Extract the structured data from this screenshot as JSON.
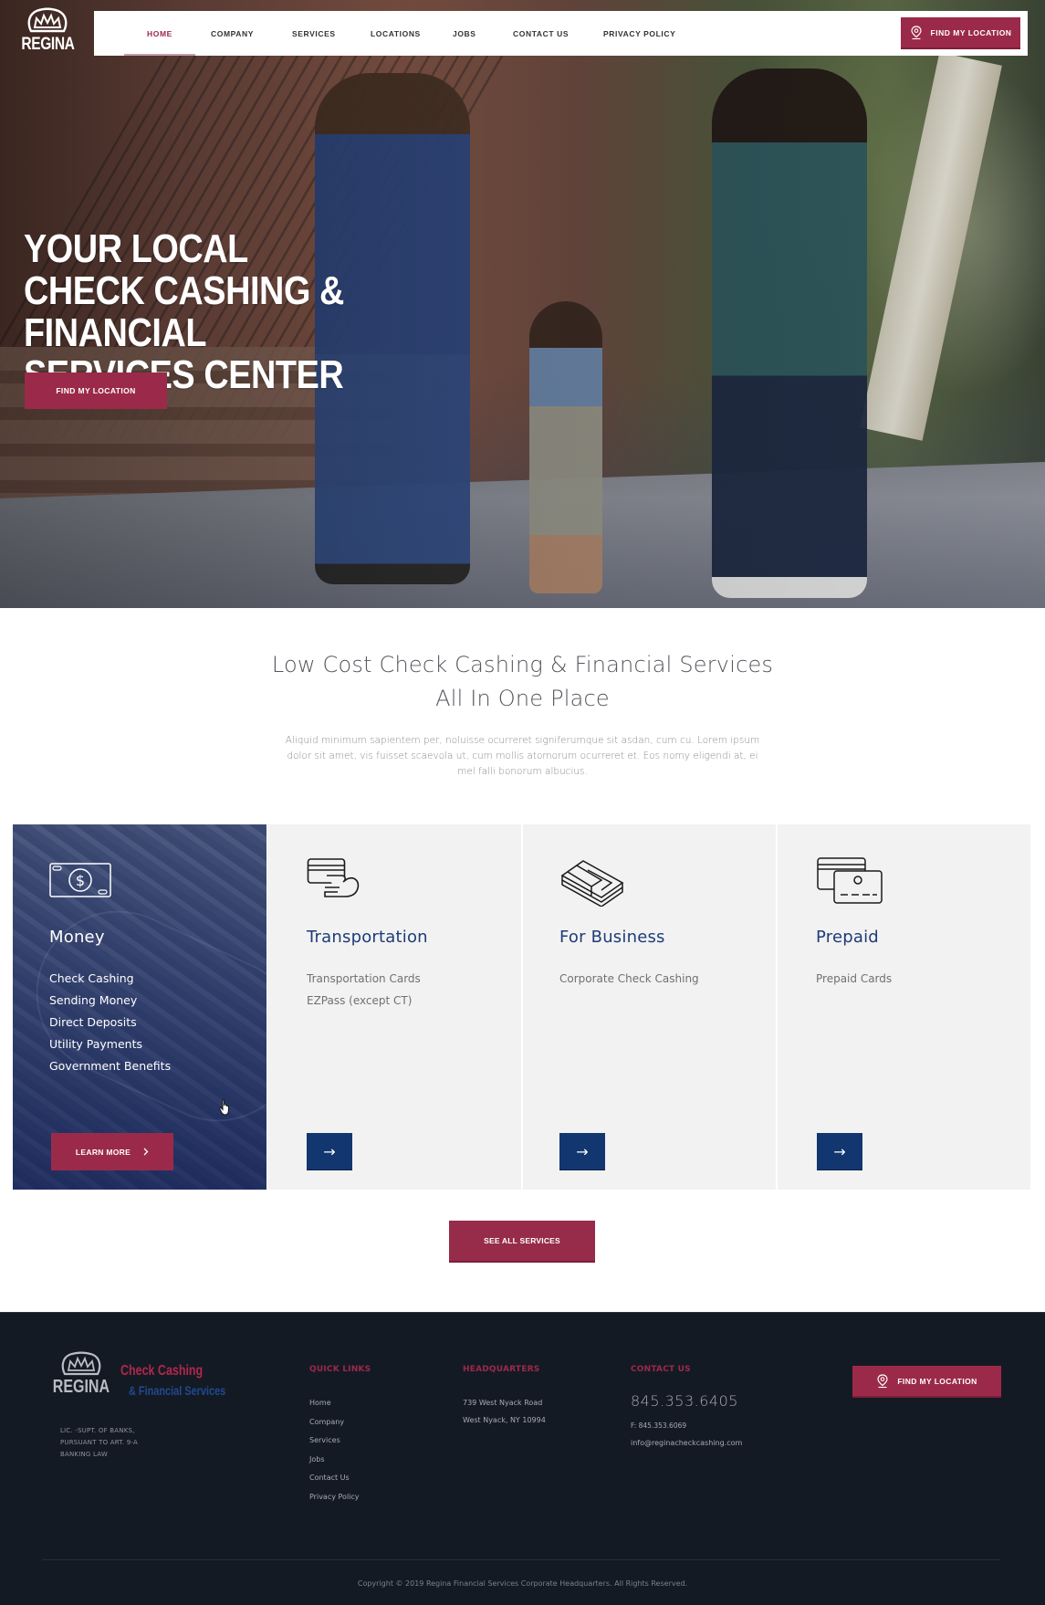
{
  "brand": {
    "logo_word": "REGINA",
    "colors": {
      "primary": "#9b2a4a",
      "navy": "#12366f",
      "footer_bg": "#141a24",
      "card_bg": "#f2f2f2"
    }
  },
  "nav": {
    "items": [
      {
        "label": "HOME",
        "active": true
      },
      {
        "label": "COMPANY",
        "active": false
      },
      {
        "label": "SERVICES",
        "active": false
      },
      {
        "label": "LOCATIONS",
        "active": false
      },
      {
        "label": "JOBS",
        "active": false
      },
      {
        "label": "CONTACT US",
        "active": false
      },
      {
        "label": "PRIVACY POLICY",
        "active": false
      }
    ],
    "cta_label": "FIND MY LOCATION",
    "cta_icon": "map-pin-icon"
  },
  "hero": {
    "title": "YOUR LOCAL CHECK CASHING & FINANCIAL SERVICES CENTER",
    "cta_label": "FIND MY LOCATION"
  },
  "intro": {
    "heading_line1": "Low Cost Check Cashing & Financial Services",
    "heading_line2": "All In One Place",
    "body": "Aliquid minimum sapientem per, noluisse ocurreret signiferumque sit asdan, cum cu. Lorem ipsum dolor sit amet, vis fuisset scaevola ut, cum mollis atomorum ocurreret et. Eos nomy eligendi at, ei mel falli bonorum albucius."
  },
  "services": [
    {
      "title": "Money",
      "icon": "cash-bill-icon",
      "items": [
        "Check Cashing",
        "Sending Money",
        "Direct Deposits",
        "Utility Payments",
        "Government Benefits"
      ],
      "button": "LEARN MORE",
      "button_icon": "chevron-right-icon"
    },
    {
      "title": "Transportation",
      "icon": "card-in-hand-icon",
      "items": [
        "Transportation Cards",
        "EZPass (except CT)"
      ],
      "button": "→"
    },
    {
      "title": "For Business",
      "icon": "money-stack-icon",
      "items": [
        "Corporate Check Cashing"
      ],
      "button": "→"
    },
    {
      "title": "Prepaid",
      "icon": "prepaid-card-icon",
      "items": [
        "Prepaid Cards"
      ],
      "button": "→"
    }
  ],
  "see_all_label": "SEE ALL SERVICES",
  "footer": {
    "logo_word": "REGINA",
    "brand_line1": "Check Cashing",
    "brand_line2": "& Financial Services",
    "license": [
      "LIC. -SUPT. OF BANKS,",
      "PURSUANT TO ART. 9-A",
      "BANKING LAW"
    ],
    "quick_links_title": "QUICK LINKS",
    "quick_links": [
      "Home",
      "Company",
      "Services",
      "Jobs",
      "Contact Us",
      "Privacy Policy"
    ],
    "hq_title": "HEADQUARTERS",
    "hq_address": [
      "739 West Nyack Road",
      "West Nyack, NY 10994"
    ],
    "contact_title": "CONTACT US",
    "phone": "845.353.6405",
    "fax": "F: 845.353.6069",
    "email": "info@reginacheckcashing.com",
    "cta_label": "FIND MY LOCATION",
    "copyright": "Copyright © 2019 Regina Financial Services Corporate Headquarters. All Rights Reserved."
  }
}
